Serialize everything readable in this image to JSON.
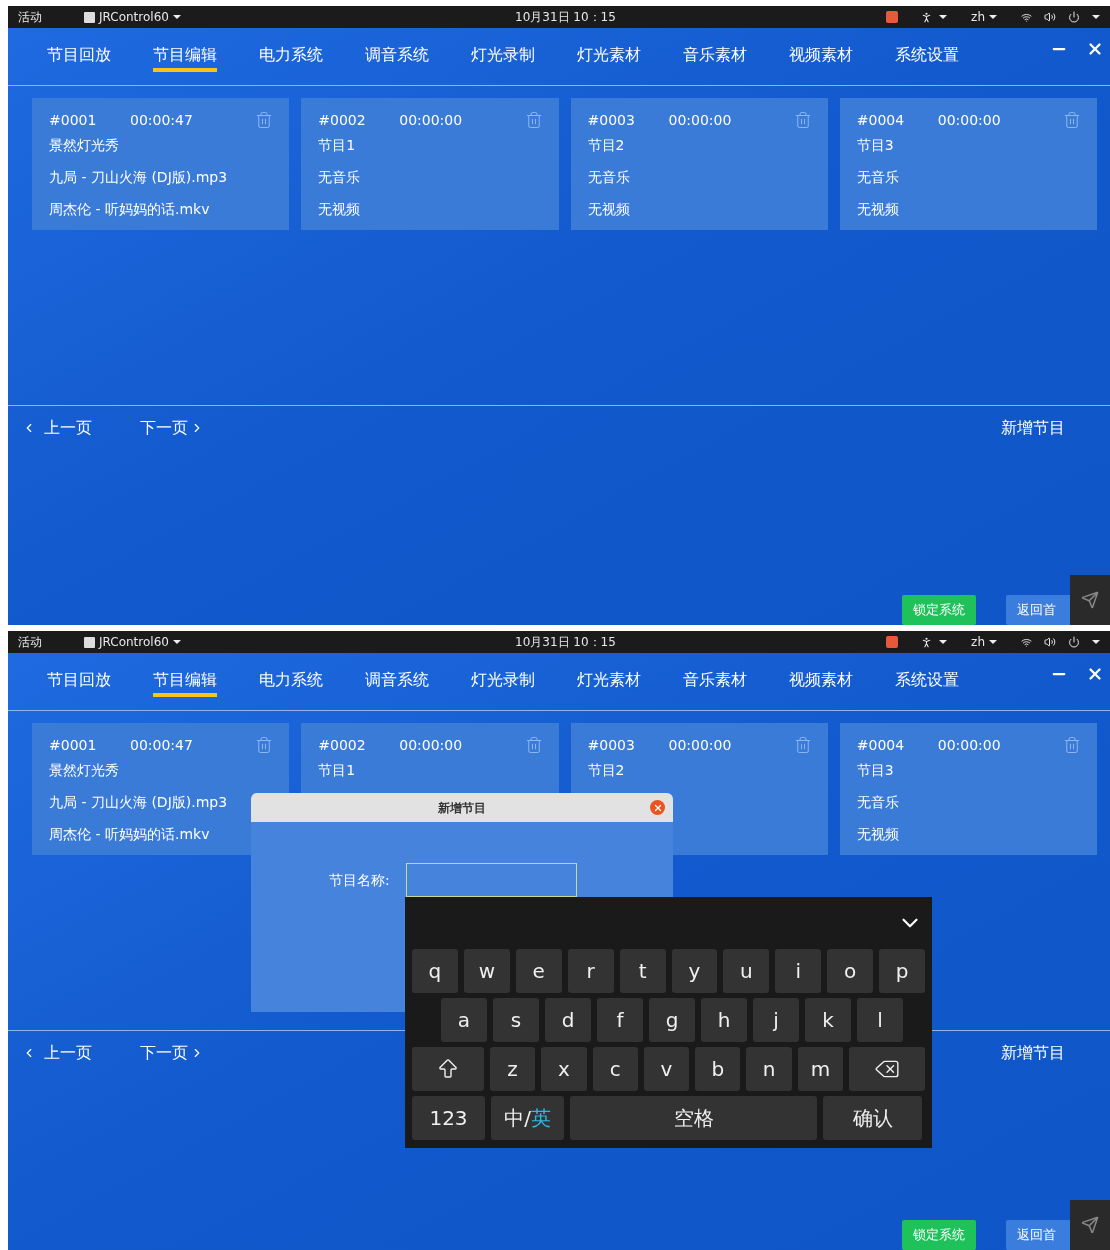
{
  "screens": [
    {
      "system_bar": {
        "activities": "活动",
        "app_menu": "JRControl60",
        "clock": "10月31日 10：15",
        "input_method": "zh"
      },
      "tabs": [
        {
          "label": "节目回放",
          "selected": false
        },
        {
          "label": "节目编辑",
          "selected": true
        },
        {
          "label": "电力系统",
          "selected": false
        },
        {
          "label": "调音系统",
          "selected": false
        },
        {
          "label": "灯光录制",
          "selected": false
        },
        {
          "label": "灯光素材",
          "selected": false
        },
        {
          "label": "音乐素材",
          "selected": false
        },
        {
          "label": "视频素材",
          "selected": false
        },
        {
          "label": "系统设置",
          "selected": false
        }
      ],
      "cards": [
        {
          "id": "#0001",
          "time": "00:00:47",
          "name": "景然灯光秀",
          "music": "九局 - 刀山火海 (DJ版).mp3",
          "video": "周杰伦 - 听妈妈的话.mkv"
        },
        {
          "id": "#0002",
          "time": "00:00:00",
          "name": "节目1",
          "music": "无音乐",
          "video": "无视频"
        },
        {
          "id": "#0003",
          "time": "00:00:00",
          "name": "节目2",
          "music": "无音乐",
          "video": "无视频"
        },
        {
          "id": "#0004",
          "time": "00:00:00",
          "name": "节目3",
          "music": "无音乐",
          "video": "无视频"
        }
      ],
      "pager": {
        "previous": "上一页",
        "next": "下一页"
      },
      "add_button": "新增节目",
      "lock_button": "锁定系统",
      "home_button": "返回首"
    },
    {
      "system_bar": {
        "activities": "活动",
        "app_menu": "JRControl60",
        "clock": "10月31日 10：15",
        "input_method": "zh"
      },
      "tabs": [
        {
          "label": "节目回放",
          "selected": false
        },
        {
          "label": "节目编辑",
          "selected": true
        },
        {
          "label": "电力系统",
          "selected": false
        },
        {
          "label": "调音系统",
          "selected": false
        },
        {
          "label": "灯光录制",
          "selected": false
        },
        {
          "label": "灯光素材",
          "selected": false
        },
        {
          "label": "音乐素材",
          "selected": false
        },
        {
          "label": "视频素材",
          "selected": false
        },
        {
          "label": "系统设置",
          "selected": false
        }
      ],
      "cards": [
        {
          "id": "#0001",
          "time": "00:00:47",
          "name": "景然灯光秀",
          "music": "九局 - 刀山火海 (DJ版).mp3",
          "video": "周杰伦 - 听妈妈的话.mkv"
        },
        {
          "id": "#0002",
          "time": "00:00:00",
          "name": "节目1"
        },
        {
          "id": "#0003",
          "time": "00:00:00",
          "name": "节目2"
        },
        {
          "id": "#0004",
          "time": "00:00:00",
          "name": "节目3",
          "music": "无音乐",
          "video": "无视频"
        }
      ],
      "pager": {
        "previous": "上一页",
        "next": "下一页"
      },
      "add_button": "新增节目",
      "lock_button": "锁定系统",
      "home_button": "返回首",
      "dialog": {
        "title": "新增节目",
        "field_label": "节目名称:"
      },
      "keyboard": {
        "rows": [
          [
            {
              "kind": "char",
              "label": "q"
            },
            {
              "kind": "char",
              "label": "w"
            },
            {
              "kind": "char",
              "label": "e"
            },
            {
              "kind": "char",
              "label": "r"
            },
            {
              "kind": "char",
              "label": "t"
            },
            {
              "kind": "char",
              "label": "y"
            },
            {
              "kind": "char",
              "label": "u"
            },
            {
              "kind": "char",
              "label": "i"
            },
            {
              "kind": "char",
              "label": "o"
            },
            {
              "kind": "char",
              "label": "p"
            }
          ],
          [
            {
              "kind": "char",
              "label": "a"
            },
            {
              "kind": "char",
              "label": "s"
            },
            {
              "kind": "char",
              "label": "d"
            },
            {
              "kind": "char",
              "label": "f"
            },
            {
              "kind": "char",
              "label": "g"
            },
            {
              "kind": "char",
              "label": "h"
            },
            {
              "kind": "char",
              "label": "j"
            },
            {
              "kind": "char",
              "label": "k"
            },
            {
              "kind": "char",
              "label": "l"
            }
          ],
          [
            {
              "kind": "shift"
            },
            {
              "kind": "char",
              "label": "z"
            },
            {
              "kind": "char",
              "label": "x"
            },
            {
              "kind": "char",
              "label": "c"
            },
            {
              "kind": "char",
              "label": "v"
            },
            {
              "kind": "char",
              "label": "b"
            },
            {
              "kind": "char",
              "label": "n"
            },
            {
              "kind": "char",
              "label": "m"
            },
            {
              "kind": "backspace"
            }
          ]
        ],
        "numbers_key": "123",
        "mode_key": {
          "primary": "中/",
          "active": "英"
        },
        "space_key": "空格",
        "confirm_key": "确认"
      }
    }
  ]
}
